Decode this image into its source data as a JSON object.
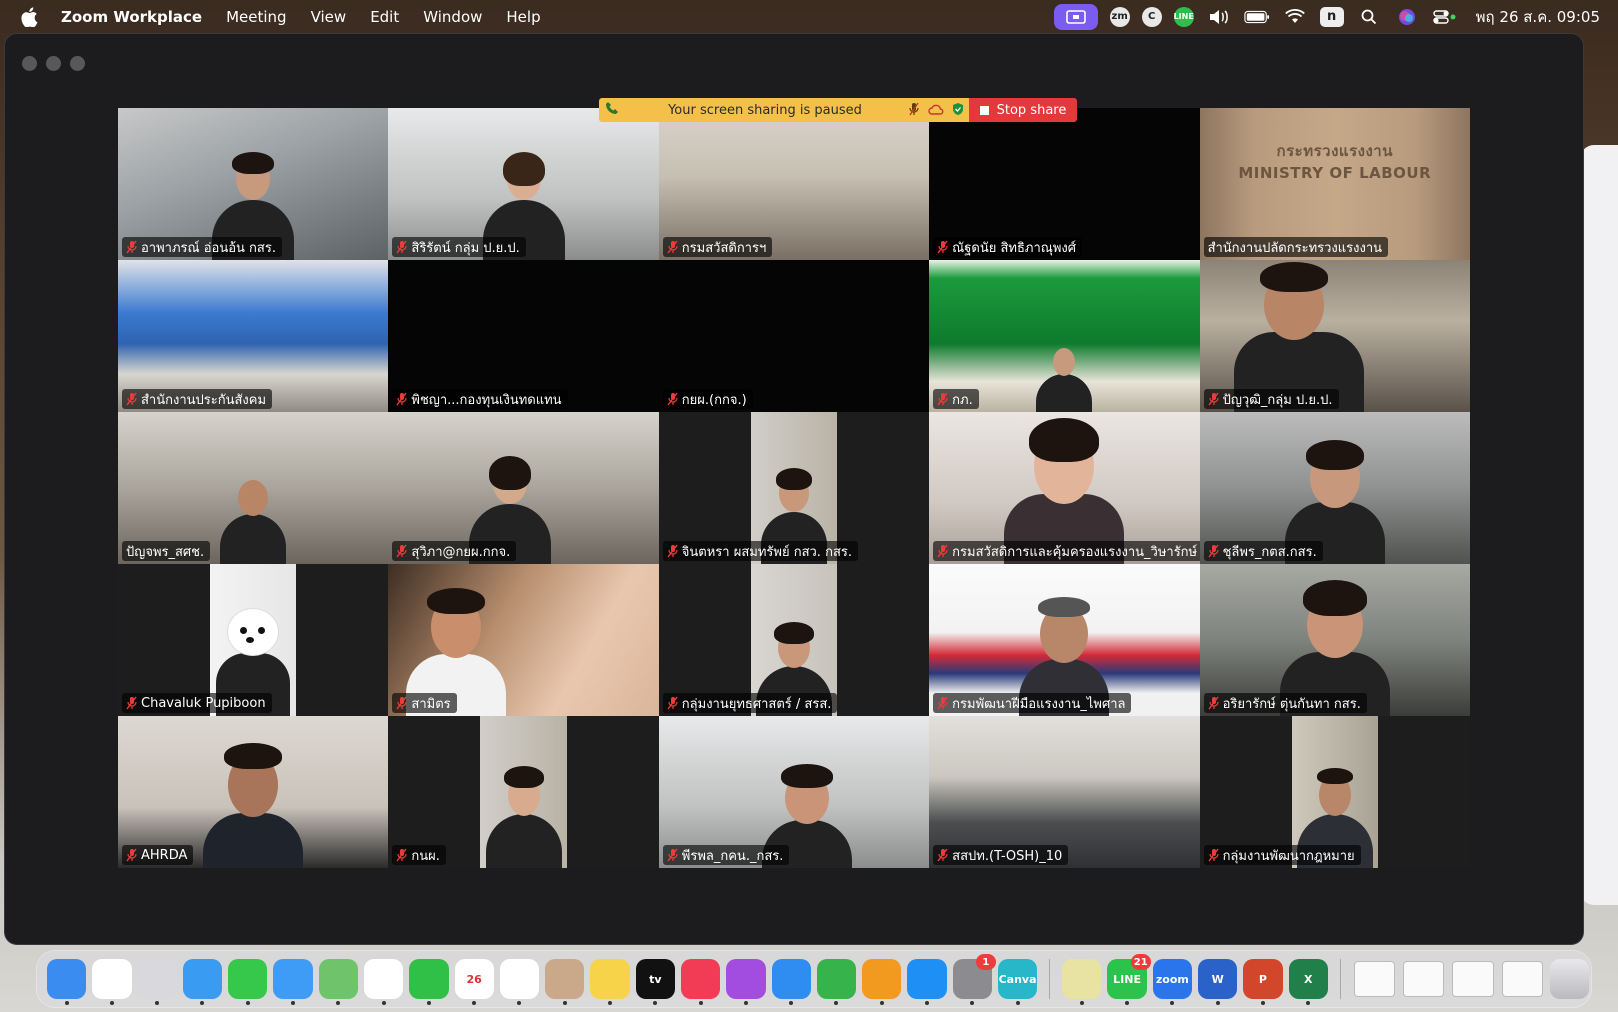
{
  "menubar": {
    "app_name": "Zoom Workplace",
    "items": [
      "Meeting",
      "View",
      "Edit",
      "Window",
      "Help"
    ],
    "status_icons": [
      "screen-share-icon",
      "zoom-icon",
      "c-icon",
      "line-icon",
      "volume-icon",
      "battery-icon",
      "wifi-icon",
      "n-icon",
      "spotlight-search-icon",
      "siri-icon",
      "control-center-icon"
    ],
    "zm_label": "zm",
    "c_label": "C",
    "line_label": "LINE",
    "n_label": "n",
    "clock": "พฤ 26 ส.ค. 09:05"
  },
  "share_banner": {
    "message": "Your screen sharing is paused",
    "stop_label": "Stop share"
  },
  "participants": [
    {
      "name": "อาพาภรณ์ อ่อนอ้น กสร.",
      "muted": true
    },
    {
      "name": "สิริรัตน์ กลุ่ม ป.ย.ป.",
      "muted": true
    },
    {
      "name": "กรมสวัสดิการฯ",
      "muted": true
    },
    {
      "name": "ณัฐดนัย สิทธิภาณุพงศ์",
      "muted": true
    },
    {
      "name": "สำนักงานปลัดกระทรวงแรงงาน",
      "muted": false
    },
    {
      "name": "สำนักงานประกันสังคม",
      "muted": true
    },
    {
      "name": "พิชญา...กองทุนเงินทดแทน",
      "muted": true
    },
    {
      "name": "กยผ.(กกจ.)",
      "muted": true
    },
    {
      "name": "กภ.",
      "muted": true
    },
    {
      "name": "ปัญวุฒิ_กลุ่ม ป.ย.ป.",
      "muted": true
    },
    {
      "name": "ปัญจพร_สศช.",
      "muted": false
    },
    {
      "name": "สุวิภา@กยผ.กกจ.",
      "muted": true
    },
    {
      "name": "จินตหรา ผสมทรัพย์ กสว. กสร.",
      "muted": true
    },
    {
      "name": "กรมสวัสดิการและคุ้มครองแรงงาน_วิษารักษ์",
      "muted": true
    },
    {
      "name": "ชุลีพร_กตส.กสร.",
      "muted": true
    },
    {
      "name": "Chavaluk Pupiboon",
      "muted": true
    },
    {
      "name": "สามิตร",
      "muted": true
    },
    {
      "name": "กลุ่มงานยุทธศาสตร์ / สรส.",
      "muted": true
    },
    {
      "name": "กรมพัฒนาฝีมือแรงงาน_ไพศาล",
      "muted": true
    },
    {
      "name": "อริยารักษ์ ตุ่นกันทา กสร.",
      "muted": true
    },
    {
      "name": "AHRDA",
      "muted": true
    },
    {
      "name": "กนผ.",
      "muted": true
    },
    {
      "name": "พีรพล_กคน._กสร.",
      "muted": true
    },
    {
      "name": "สสปท.(T-OSH)_10",
      "muted": true
    },
    {
      "name": "กลุ่มงานพัฒนากฎหมาย",
      "muted": true
    }
  ],
  "ministry_sign": {
    "line1": "กระทรวงแรงงาน",
    "line2": "MINISTRY OF LABOUR"
  },
  "dock": {
    "apps": [
      {
        "name": "finder-icon",
        "color": "#3b8cf0",
        "label": ""
      },
      {
        "name": "chrome-icon",
        "color": "#ffffff",
        "label": ""
      },
      {
        "name": "launchpad-icon",
        "color": "#d9d9dd",
        "label": ""
      },
      {
        "name": "safari-icon",
        "color": "#3a9bf2",
        "label": ""
      },
      {
        "name": "messages-icon",
        "color": "#35c84a",
        "label": ""
      },
      {
        "name": "mail-icon",
        "color": "#3f9cf6",
        "label": ""
      },
      {
        "name": "maps-icon",
        "color": "#6fc46b",
        "label": ""
      },
      {
        "name": "photos-icon",
        "color": "#ffffff",
        "label": ""
      },
      {
        "name": "facetime-icon",
        "color": "#30c048",
        "label": ""
      },
      {
        "name": "calendar-icon",
        "color": "#ffffff",
        "label": "26"
      },
      {
        "name": "reminders-icon",
        "color": "#ffffff",
        "label": ""
      },
      {
        "name": "contacts-icon",
        "color": "#c9a98a",
        "label": ""
      },
      {
        "name": "notes-icon",
        "color": "#f7d34a",
        "label": ""
      },
      {
        "name": "apple-tv-icon",
        "color": "#111111",
        "label": "tv"
      },
      {
        "name": "music-icon",
        "color": "#f23c55",
        "label": ""
      },
      {
        "name": "podcasts-icon",
        "color": "#a24de0",
        "label": ""
      },
      {
        "name": "keynote-icon",
        "color": "#2f8cf0",
        "label": ""
      },
      {
        "name": "numbers-icon",
        "color": "#36b34a",
        "label": ""
      },
      {
        "name": "pages-icon",
        "color": "#f29a1f",
        "label": ""
      },
      {
        "name": "app-store-icon",
        "color": "#1e8ff5",
        "label": ""
      },
      {
        "name": "system-settings-icon",
        "color": "#8c8c90",
        "label": "",
        "badge": "1"
      },
      {
        "name": "canva-icon",
        "color": "#27b7c8",
        "label": "Canva"
      }
    ],
    "apps2": [
      {
        "name": "preview-icon",
        "color": "#e9e3a3",
        "label": ""
      },
      {
        "name": "line-icon",
        "color": "#2cc34c",
        "label": "LINE",
        "badge": "21"
      },
      {
        "name": "zoom-icon",
        "color": "#2a74ec",
        "label": "zoom"
      },
      {
        "name": "word-icon",
        "color": "#2a62c9",
        "label": "W"
      },
      {
        "name": "powerpoint-icon",
        "color": "#d2462b",
        "label": "P"
      },
      {
        "name": "excel-icon",
        "color": "#21804a",
        "label": "X"
      }
    ],
    "thumbs": 4,
    "trash": "trash-icon"
  }
}
